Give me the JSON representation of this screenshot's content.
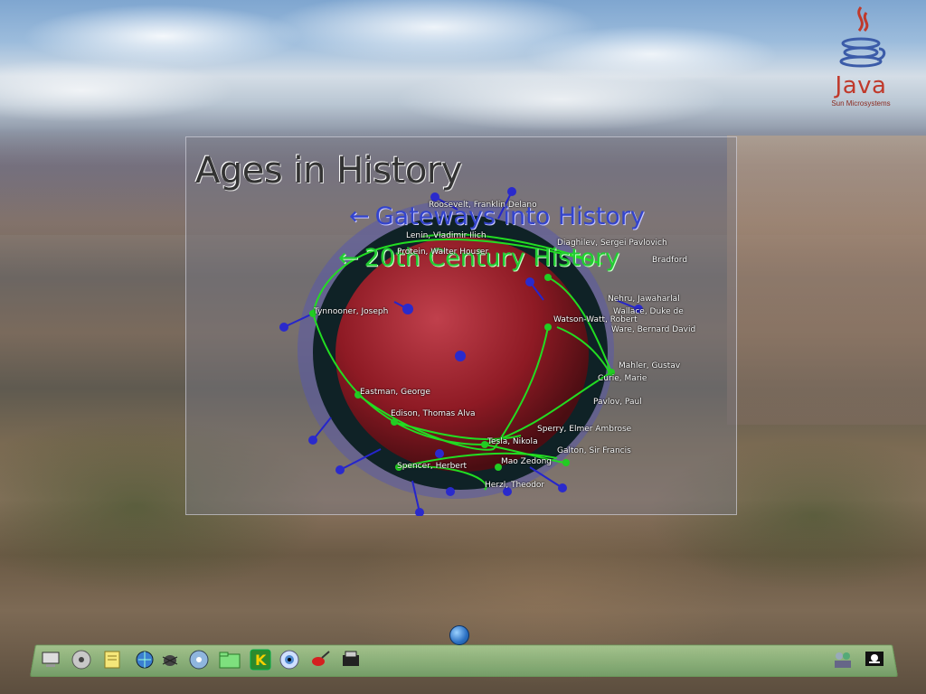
{
  "java": {
    "word": "Java",
    "company": "Sun Microsystems"
  },
  "panel": {
    "title": "Ages in History",
    "links": [
      {
        "label": "Gateways into History",
        "arrow": "←"
      },
      {
        "label": "20th Century History",
        "arrow": "←"
      }
    ]
  },
  "people": [
    "Roosevelt, Franklin Delano",
    "Lenin, Vladimir Ilich",
    "Protein, Walter Houser",
    "Tynnooner, Joseph",
    "Diaghilev, Sergei Pavlovich",
    "Bradford",
    "Nehru, Jawaharlal",
    "Watson-Watt, Robert",
    "Wallace, Duke de",
    "Ware, Bernard David",
    "Mahler, Gustav",
    "Curie, Marie",
    "Eastman, George",
    "Edison, Thomas Alva",
    "Pavlov, Paul",
    "Sperry, Elmer Ambrose",
    "Tesla, Nikola",
    "Galton, Sir Francis",
    "Spencer, Herbert",
    "Mao Zedong",
    "Herzl, Theodor"
  ],
  "taskbar": {
    "icons": [
      "computer-icon",
      "cd-icon",
      "notes-icon",
      "network-icon",
      "bug-icon",
      "disc-icon",
      "folder-icon",
      "k-icon",
      "eye-icon",
      "brush-icon",
      "film-icon"
    ],
    "tray": [
      "people-icon",
      "pirate-flag-icon"
    ]
  },
  "colors": {
    "link_gateways": "#3344cc",
    "link_20th": "#22cc33",
    "sphere": "#9b1f2a",
    "edges": "#22dd22"
  }
}
